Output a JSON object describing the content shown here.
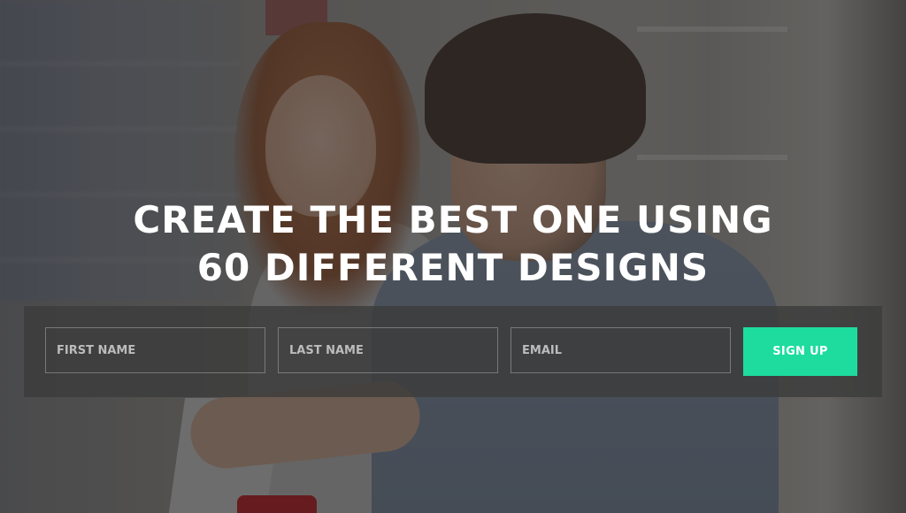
{
  "hero": {
    "headline_line1": "CREATE THE BEST ONE USING",
    "headline_line2": "60 DIFFERENT DESIGNS",
    "background_image": "two-people-at-laptop-photo"
  },
  "form": {
    "first_name_placeholder": "FIRST NAME",
    "last_name_placeholder": "LAST NAME",
    "email_placeholder": "EMAIL",
    "signup_label": "SIGN UP"
  },
  "colors": {
    "accent": "#1ddc9d",
    "text": "#ffffff",
    "panel": "#3c3c3c"
  }
}
